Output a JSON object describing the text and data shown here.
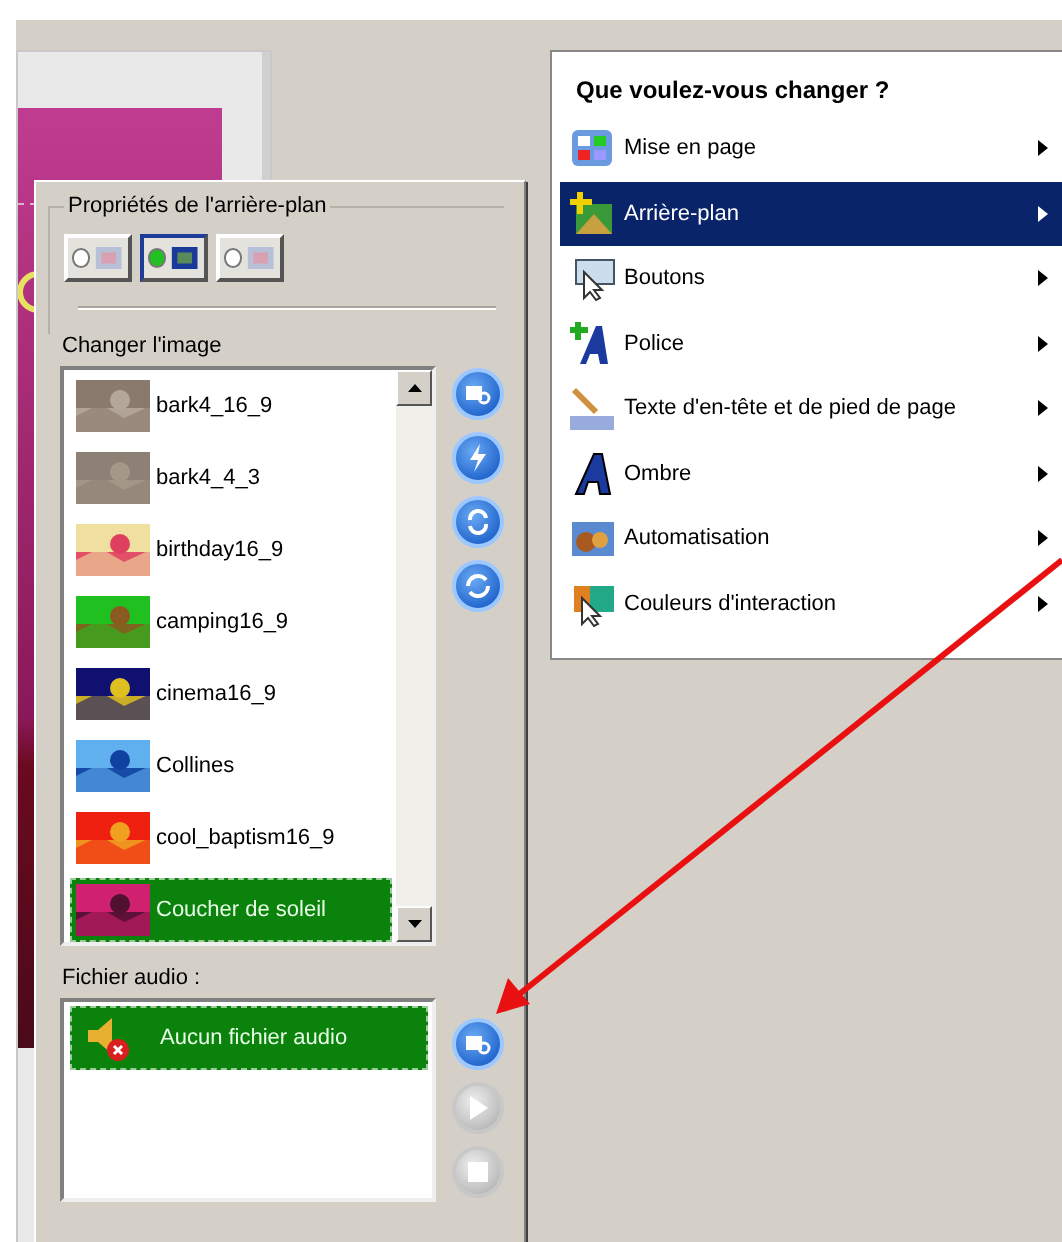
{
  "background_panel": {
    "title": "Propriétés de l'arrière-plan",
    "options": [
      {
        "selected": false
      },
      {
        "selected": true
      },
      {
        "selected": false
      }
    ]
  },
  "image_list": {
    "label": "Changer l'image",
    "items": [
      {
        "name": "bark4_16_9",
        "selected": false
      },
      {
        "name": "bark4_4_3",
        "selected": false
      },
      {
        "name": "birthday16_9",
        "selected": false
      },
      {
        "name": "camping16_9",
        "selected": false
      },
      {
        "name": "cinema16_9",
        "selected": false
      },
      {
        "name": "Collines",
        "selected": false
      },
      {
        "name": "cool_baptism16_9",
        "selected": false
      },
      {
        "name": "Coucher de soleil",
        "selected": true
      }
    ]
  },
  "audio": {
    "label": "Fichier audio :",
    "items": [
      {
        "name": "Aucun fichier audio",
        "selected": true
      }
    ],
    "buttons": [
      {
        "kind": "browse",
        "disabled": false
      },
      {
        "kind": "play",
        "disabled": true
      },
      {
        "kind": "stop",
        "disabled": true
      }
    ]
  },
  "menu": {
    "title": "Que voulez-vous changer ?",
    "items": [
      {
        "label": "Mise en page",
        "selected": false
      },
      {
        "label": "Arrière-plan",
        "selected": true
      },
      {
        "label": "Boutons",
        "selected": false
      },
      {
        "label": "Police",
        "selected": false
      },
      {
        "label": "Texte d'en-tête et de pied de page",
        "selected": false
      },
      {
        "label": "Ombre",
        "selected": false
      },
      {
        "label": "Automatisation",
        "selected": false
      },
      {
        "label": "Couleurs d'interaction",
        "selected": false
      }
    ]
  }
}
